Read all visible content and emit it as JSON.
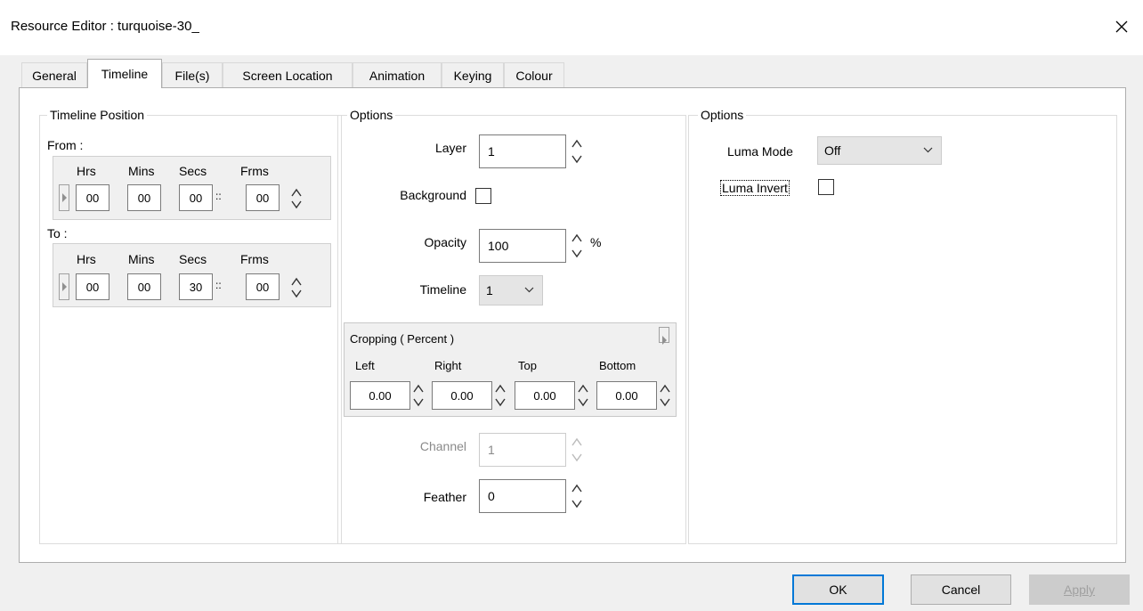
{
  "window": {
    "title": "Resource Editor  :  turquoise-30_"
  },
  "tabs": [
    "General",
    "Timeline",
    "File(s)",
    "Screen Location",
    "Animation",
    "Keying",
    "Colour"
  ],
  "timeline_position": {
    "legend": "Timeline Position",
    "from_label": "From :",
    "to_label": "To :",
    "headers": [
      "Hrs",
      "Mins",
      "Secs",
      "Frms"
    ],
    "separator": "::",
    "from": [
      "00",
      "00",
      "00",
      "00"
    ],
    "to": [
      "00",
      "00",
      "30",
      "00"
    ]
  },
  "options_mid": {
    "legend": "Options",
    "layer_label": "Layer",
    "layer_value": "1",
    "background_label": "Background",
    "opacity_label": "Opacity",
    "opacity_value": "100",
    "opacity_unit": "%",
    "timeline_label": "Timeline",
    "timeline_value": "1",
    "cropping": {
      "title": "Cropping ( Percent )",
      "headers": [
        "Left",
        "Right",
        "Top",
        "Bottom"
      ],
      "values": [
        "0.00",
        "0.00",
        "0.00",
        "0.00"
      ]
    },
    "channel_label": "Channel",
    "channel_value": "1",
    "feather_label": "Feather",
    "feather_value": "0"
  },
  "options_right": {
    "legend": "Options",
    "luma_mode_label": "Luma Mode",
    "luma_mode_value": "Off",
    "luma_invert_label": "Luma Invert"
  },
  "buttons": {
    "ok": "OK",
    "cancel": "Cancel",
    "apply": "Apply"
  }
}
